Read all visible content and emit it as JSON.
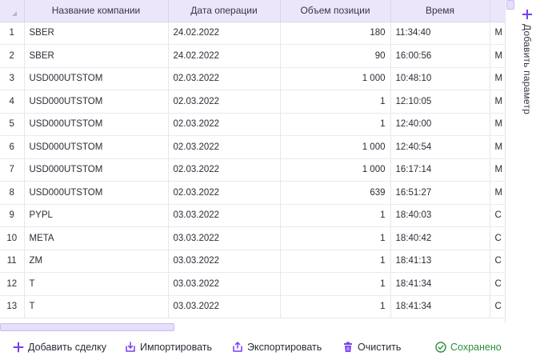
{
  "grid": {
    "columns": [
      "Название компании",
      "Дата операции",
      "Объем позиции",
      "Время"
    ],
    "rows": [
      {
        "n": "1",
        "name": "SBER",
        "date": "24.02.2022",
        "volume": "180",
        "time": "11:34:40",
        "extra": "M"
      },
      {
        "n": "2",
        "name": "SBER",
        "date": "24.02.2022",
        "volume": "90",
        "time": "16:00:56",
        "extra": "M"
      },
      {
        "n": "3",
        "name": "USD000UTSTOM",
        "date": "02.03.2022",
        "volume": "1 000",
        "time": "10:48:10",
        "extra": "M"
      },
      {
        "n": "4",
        "name": "USD000UTSTOM",
        "date": "02.03.2022",
        "volume": "1",
        "time": "12:10:05",
        "extra": "M"
      },
      {
        "n": "5",
        "name": "USD000UTSTOM",
        "date": "02.03.2022",
        "volume": "1",
        "time": "12:40:00",
        "extra": "M"
      },
      {
        "n": "6",
        "name": "USD000UTSTOM",
        "date": "02.03.2022",
        "volume": "1 000",
        "time": "12:40:54",
        "extra": "M"
      },
      {
        "n": "7",
        "name": "USD000UTSTOM",
        "date": "02.03.2022",
        "volume": "1 000",
        "time": "16:17:14",
        "extra": "M"
      },
      {
        "n": "8",
        "name": "USD000UTSTOM",
        "date": "02.03.2022",
        "volume": "639",
        "time": "16:51:27",
        "extra": "M"
      },
      {
        "n": "9",
        "name": "PYPL",
        "date": "03.03.2022",
        "volume": "1",
        "time": "18:40:03",
        "extra": "C"
      },
      {
        "n": "10",
        "name": "META",
        "date": "03.03.2022",
        "volume": "1",
        "time": "18:40:42",
        "extra": "C"
      },
      {
        "n": "11",
        "name": "ZM",
        "date": "03.03.2022",
        "volume": "1",
        "time": "18:41:13",
        "extra": "C"
      },
      {
        "n": "12",
        "name": "T",
        "date": "03.03.2022",
        "volume": "1",
        "time": "18:41:34",
        "extra": "C"
      },
      {
        "n": "13",
        "name": "T",
        "date": "03.03.2022",
        "volume": "1",
        "time": "18:41:34",
        "extra": "C"
      }
    ]
  },
  "side_panel": {
    "add_param_label": "Добавить параметр",
    "icon": "plus-icon"
  },
  "toolbar": {
    "add_deal": "Добавить сделку",
    "import": "Импортировать",
    "export": "Экспортировать",
    "clear": "Очистить",
    "status": "Сохранено"
  },
  "colors": {
    "accent": "#7a3df0",
    "header_bg": "#ece6fb",
    "saved": "#2e8f3a"
  }
}
